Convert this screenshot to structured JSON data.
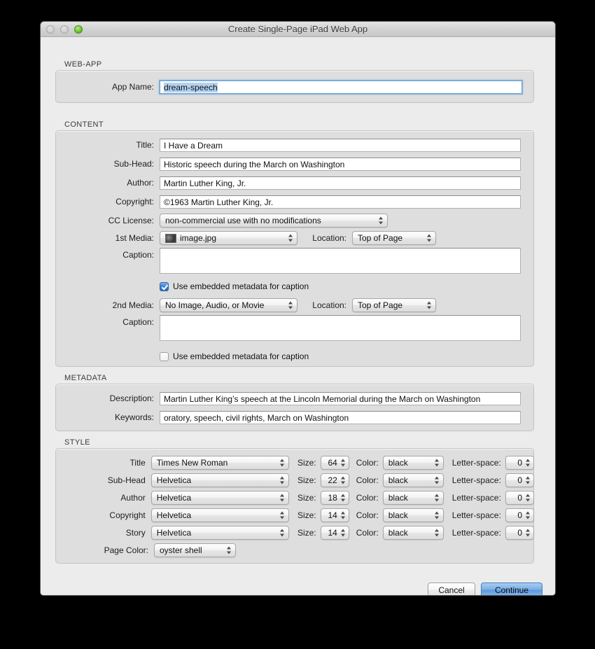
{
  "window": {
    "title": "Create Single-Page iPad Web App",
    "traffic_lights": [
      {
        "name": "close",
        "state": "disabled"
      },
      {
        "name": "minimize",
        "state": "disabled"
      },
      {
        "name": "zoom",
        "state": "enabled",
        "color": "#72c32f"
      }
    ]
  },
  "webapp": {
    "group_label": "WEB-APP",
    "app_name_label": "App Name:",
    "app_name_value": "dream-speech",
    "app_name_selected": true
  },
  "content": {
    "group_label": "CONTENT",
    "fields": [
      {
        "label": "Title:",
        "value": "I Have a Dream"
      },
      {
        "label": "Sub-Head:",
        "value": "Historic speech during the March on Washington"
      },
      {
        "label": "Author:",
        "value": "Martin Luther King, Jr."
      },
      {
        "label": "Copyright:",
        "value": "©1963 Martin Luther King, Jr."
      }
    ],
    "cc_license_label": "CC License:",
    "cc_license_value": "non-commercial use with no modifications",
    "media1": {
      "label": "1st Media:",
      "value": "image.jpg",
      "has_thumbnail": true,
      "location_label": "Location:",
      "location_value": "Top of Page",
      "caption_label": "Caption:",
      "caption_value": "",
      "metadata_checkbox_label": "Use embedded metadata for caption",
      "metadata_checked": true
    },
    "media2": {
      "label": "2nd Media:",
      "value": "No Image, Audio, or Movie",
      "has_thumbnail": false,
      "location_label": "Location:",
      "location_value": "Top of Page",
      "caption_label": "Caption:",
      "caption_value": "",
      "metadata_checkbox_label": "Use embedded metadata for caption",
      "metadata_checked": false
    }
  },
  "metadata": {
    "group_label": "METADATA",
    "description_label": "Description:",
    "description_value": "Martin Luther King’s speech at the Lincoln Memorial during the March on Washington",
    "keywords_label": "Keywords:",
    "keywords_value": "oratory, speech, civil rights, March on Washington"
  },
  "style": {
    "group_label": "STYLE",
    "size_label": "Size:",
    "color_label": "Color:",
    "letterspace_label": "Letter-space:",
    "rows": [
      {
        "label": "Title",
        "font": "Times New Roman",
        "size": "64",
        "color": "black",
        "letterspace": "0"
      },
      {
        "label": "Sub-Head",
        "font": "Helvetica",
        "size": "22",
        "color": "black",
        "letterspace": "0"
      },
      {
        "label": "Author",
        "font": "Helvetica",
        "size": "18",
        "color": "black",
        "letterspace": "0"
      },
      {
        "label": "Copyright",
        "font": "Helvetica",
        "size": "14",
        "color": "black",
        "letterspace": "0"
      },
      {
        "label": "Story",
        "font": "Helvetica",
        "size": "14",
        "color": "black",
        "letterspace": "0"
      }
    ],
    "page_color_label": "Page Color:",
    "page_color_value": "oyster shell"
  },
  "footer": {
    "cancel_label": "Cancel",
    "continue_label": "Continue"
  }
}
